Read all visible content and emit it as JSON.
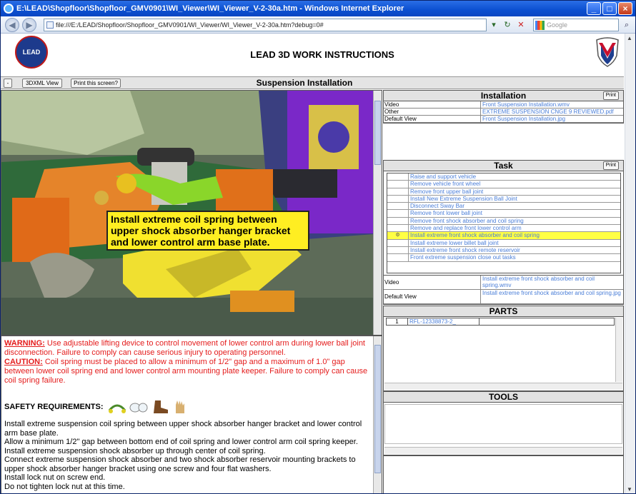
{
  "window": {
    "title": "E:\\LEAD\\Shopfloor\\Shopfloor_GMV0901\\WI_Viewer\\WI_Viewer_V-2-30a.htm - Windows Internet Explorer",
    "address": "file:///E:/LEAD/Shopfloor/Shopfloor_GMV0901/WI_Viewer/WI_Viewer_V-2-30a.htm?debug=0#",
    "search_placeholder": "Google",
    "btn_min": "_",
    "btn_max": "□",
    "btn_close": "×",
    "back": "◀",
    "forward": "▶",
    "addr_dropdown": "▾",
    "refresh": "↻",
    "stop": "✕",
    "search_go": "⌕"
  },
  "header": {
    "title": "LEAD 3D WORK INSTRUCTIONS",
    "logo_left_text": "LEAD"
  },
  "toolbar": {
    "collapse": "-",
    "xml_view": "3DXML View",
    "print_screen": "Print this screen?",
    "section_title": "Suspension Installation"
  },
  "viewer": {
    "callout": "Install extreme coil spring between upper shock absorber hanger bracket and lower control arm base plate."
  },
  "text": {
    "warning_label": "WARNING:",
    "warning_body": " Use adjustable lifting device to control movement of lower control arm during lower ball joint disconnection. Failure to comply can cause serious injury to operating personnel.",
    "caution_label": "CAUTION:",
    "caution_body": " Coil spring must be placed to allow a minimum of 1/2\" gap and a maximum of 1.0\" gap between lower coil spring end and lower control arm mounting plate keeper. Failure to comply can cause coil spring failure.",
    "safety_label": "SAFETY REQUIREMENTS:",
    "instructions": [
      "Install extreme suspension coil spring between upper shock absorber hanger bracket and lower control arm base plate.",
      "Allow a minimum 1/2\" gap between bottom end of coil spring and lower control arm coil spring keeper.",
      "Install extreme suspension shock absorber up through center of coil spring.",
      "Connect extreme suspension shock absorber and two shock absorber reservoir mounting brackets to upper shock absorber hanger bracket using one screw and four flat washers.",
      "Install lock nut on screw end.",
      "Do not tighten lock nut at this time."
    ]
  },
  "installation": {
    "title": "Installation",
    "print": "Print",
    "rows": [
      {
        "label": "Video",
        "value": "Front Suspension Installation.wmv"
      },
      {
        "label": "Other",
        "value": "EXTREME SUSPENSION CNGE 9 REVIEWED.pdf"
      },
      {
        "label": "Default View",
        "value": "Front Suspension Installation.jpg"
      }
    ]
  },
  "task": {
    "title": "Task",
    "print": "Print",
    "items": [
      "Raise and support vehicle",
      "Remove vehicle front wheel",
      "Remove front upper ball joint",
      "Install New Extreme Suspension Ball Joint",
      "Disconnect Sway Bar",
      "Remove front lower ball joint",
      "Remove front shock absorber and coil spring",
      "Remove and replace front lower control arm",
      "Install extreme front shock absorber and coil spring",
      "Install extreme lower billet ball joint",
      "Install extreme front shock remote reservoir",
      "Front extreme suspension close out tasks"
    ],
    "selected_index": 8,
    "media": [
      {
        "label": "Video",
        "value": "Install extreme front shock absorber and coil spring.wmv"
      },
      {
        "label": "Default View",
        "value": "Install extreme front shock absorber and coil spring.jpg"
      }
    ]
  },
  "parts": {
    "title": "PARTS",
    "rows": [
      {
        "num": "1",
        "part": "RFL-12338873-2_"
      }
    ]
  },
  "tools": {
    "title": "TOOLS"
  }
}
